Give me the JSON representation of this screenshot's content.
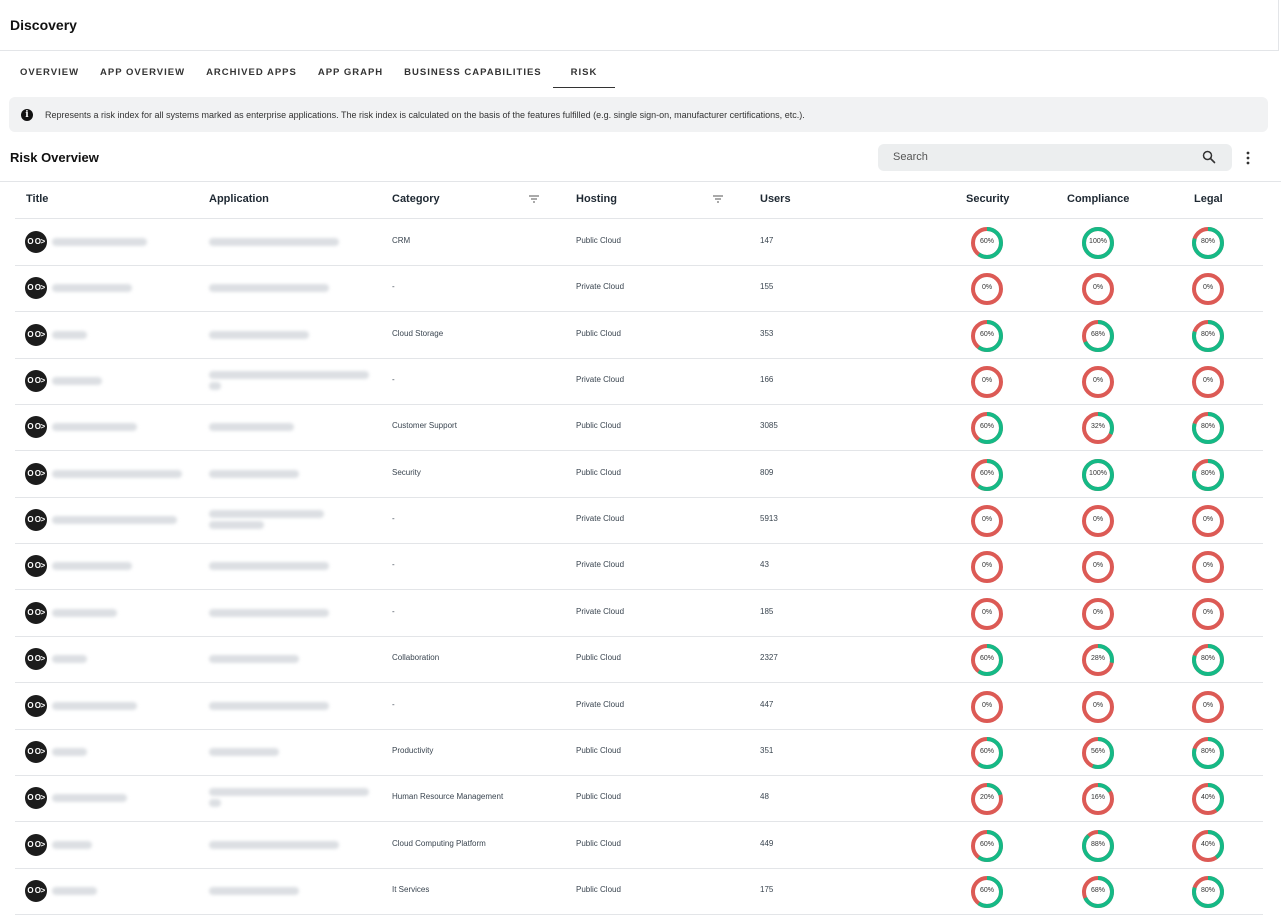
{
  "app": {
    "title": "Discovery"
  },
  "tabs": [
    {
      "label": "OVERVIEW",
      "active": false
    },
    {
      "label": "APP OVERVIEW",
      "active": false
    },
    {
      "label": "ARCHIVED APPS",
      "active": false
    },
    {
      "label": "APP GRAPH",
      "active": false
    },
    {
      "label": "BUSINESS CAPABILITIES",
      "active": false
    },
    {
      "label": "RISK",
      "active": true
    }
  ],
  "info": {
    "icon": "info-icon",
    "text": "Represents a risk index for all systems marked as enterprise applications. The risk index is calculated on the basis of the features fulfilled (e.g. single sign-on, manufacturer certifications, etc.)."
  },
  "section": {
    "title": "Risk Overview"
  },
  "search": {
    "placeholder": "Search",
    "icon": "search-icon"
  },
  "columns": {
    "title": "Title",
    "application": "Application",
    "category": "Category",
    "hosting": "Hosting",
    "users": "Users",
    "security": "Security",
    "compliance": "Compliance",
    "legal": "Legal"
  },
  "colors": {
    "good": "#15b986",
    "bad": "#dc5a55"
  },
  "rows": [
    {
      "category": "CRM",
      "hosting": "Public Cloud",
      "users": "147",
      "security": 60,
      "compliance": 100,
      "legal": 80
    },
    {
      "category": "-",
      "hosting": "Private Cloud",
      "users": "155",
      "security": 0,
      "compliance": 0,
      "legal": 0
    },
    {
      "category": "Cloud Storage",
      "hosting": "Public Cloud",
      "users": "353",
      "security": 60,
      "compliance": 68,
      "legal": 80
    },
    {
      "category": "-",
      "hosting": "Private Cloud",
      "users": "166",
      "security": 0,
      "compliance": 0,
      "legal": 0
    },
    {
      "category": "Customer Support",
      "hosting": "Public Cloud",
      "users": "3085",
      "security": 60,
      "compliance": 32,
      "legal": 80
    },
    {
      "category": "Security",
      "hosting": "Public Cloud",
      "users": "809",
      "security": 60,
      "compliance": 100,
      "legal": 80
    },
    {
      "category": "-",
      "hosting": "Private Cloud",
      "users": "5913",
      "security": 0,
      "compliance": 0,
      "legal": 0
    },
    {
      "category": "-",
      "hosting": "Private Cloud",
      "users": "43",
      "security": 0,
      "compliance": 0,
      "legal": 0
    },
    {
      "category": "-",
      "hosting": "Private Cloud",
      "users": "185",
      "security": 0,
      "compliance": 0,
      "legal": 0
    },
    {
      "category": "Collaboration",
      "hosting": "Public Cloud",
      "users": "2327",
      "security": 60,
      "compliance": 28,
      "legal": 80
    },
    {
      "category": "-",
      "hosting": "Private Cloud",
      "users": "447",
      "security": 0,
      "compliance": 0,
      "legal": 0
    },
    {
      "category": "Productivity",
      "hosting": "Public Cloud",
      "users": "351",
      "security": 60,
      "compliance": 56,
      "legal": 80
    },
    {
      "category": "Human Resource Management",
      "hosting": "Public Cloud",
      "users": "48",
      "security": 20,
      "compliance": 16,
      "legal": 40
    },
    {
      "category": "Cloud Computing Platform",
      "hosting": "Public Cloud",
      "users": "449",
      "security": 60,
      "compliance": 88,
      "legal": 40
    },
    {
      "category": "It Services",
      "hosting": "Public Cloud",
      "users": "175",
      "security": 60,
      "compliance": 68,
      "legal": 80
    }
  ]
}
